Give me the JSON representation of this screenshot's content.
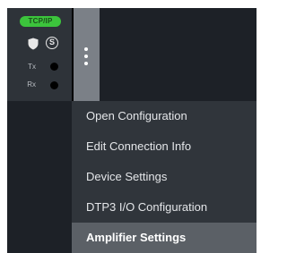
{
  "device": {
    "protocol_badge": "TCP/IP",
    "s_badge": "S",
    "tx_label": "Tx",
    "rx_label": "Rx",
    "status_colors": {
      "badge": "#3cc43c",
      "led": "#000000"
    }
  },
  "menu": {
    "items": [
      {
        "label": "Open Configuration",
        "highlighted": false
      },
      {
        "label": "Edit Connection Info",
        "highlighted": false
      },
      {
        "label": "Device Settings",
        "highlighted": false
      },
      {
        "label": "DTP3 I/O Configuration",
        "highlighted": false
      },
      {
        "label": "Amplifier Settings",
        "highlighted": true
      }
    ],
    "highlight_color": "#5b6066"
  }
}
